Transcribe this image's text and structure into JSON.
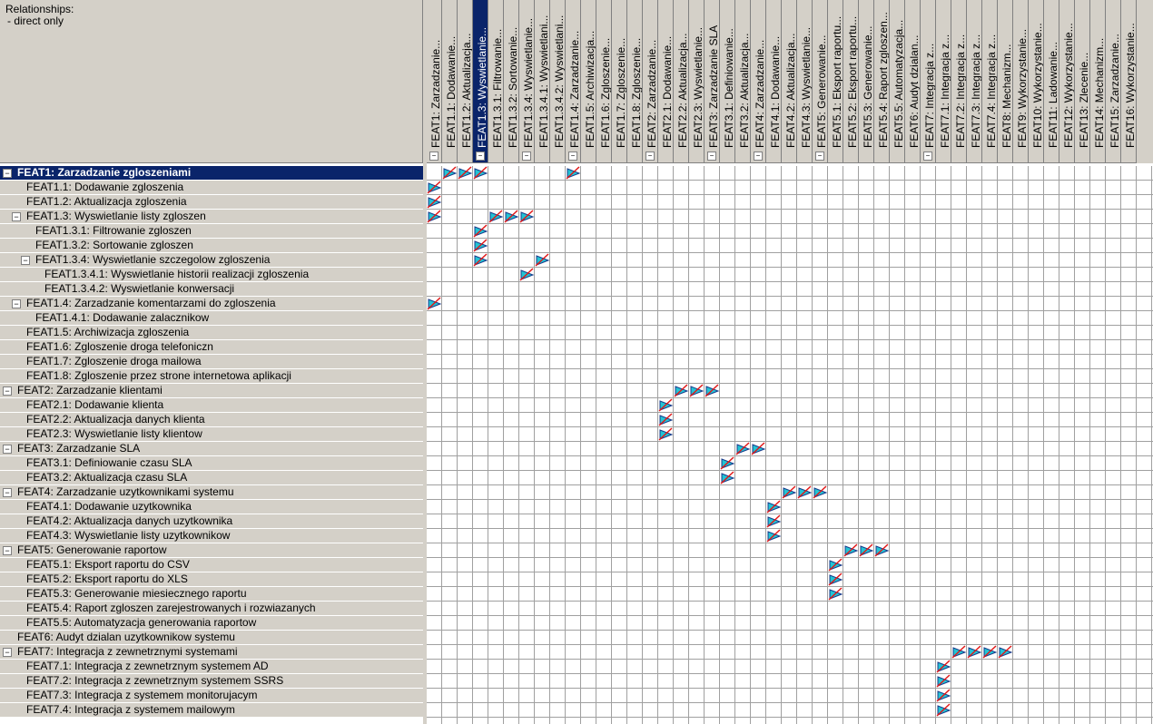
{
  "header": {
    "title": "Relationships:",
    "filter": "- direct only"
  },
  "columns": [
    {
      "label": "FEAT1: Zarzadzanie...",
      "toggle": "⊟"
    },
    {
      "label": "FEAT1.1: Dodawanie...",
      "toggle": ""
    },
    {
      "label": "FEAT1.2: Aktualizacja...",
      "toggle": ""
    },
    {
      "label": "FEAT1.3: Wyswietlanie...",
      "toggle": "⊟"
    },
    {
      "label": "FEAT1.3.1: Filtrowanie...",
      "toggle": ""
    },
    {
      "label": "FEAT1.3.2: Sortowanie...",
      "toggle": ""
    },
    {
      "label": "FEAT1.3.4: Wyswietlanie...",
      "toggle": "⊟"
    },
    {
      "label": "FEAT1.3.4.1: Wyswietlani...",
      "toggle": ""
    },
    {
      "label": "FEAT1.3.4.2: Wyswietlani...",
      "toggle": ""
    },
    {
      "label": "FEAT1.4: Zarzadzanie...",
      "toggle": "⊟"
    },
    {
      "label": "FEAT1.5: Archiwizacja...",
      "toggle": ""
    },
    {
      "label": "FEAT1.6: Zgloszenie...",
      "toggle": ""
    },
    {
      "label": "FEAT1.7: Zgloszenie...",
      "toggle": ""
    },
    {
      "label": "FEAT1.8: Zgloszenie...",
      "toggle": ""
    },
    {
      "label": "FEAT2: Zarzadzanie...",
      "toggle": "⊟"
    },
    {
      "label": "FEAT2.1: Dodawanie...",
      "toggle": ""
    },
    {
      "label": "FEAT2.2: Aktualizacja...",
      "toggle": ""
    },
    {
      "label": "FEAT2.3: Wyswietlanie...",
      "toggle": ""
    },
    {
      "label": "FEAT3: Zarzadzanie SLA",
      "toggle": "⊟"
    },
    {
      "label": "FEAT3.1: Definiowanie...",
      "toggle": ""
    },
    {
      "label": "FEAT3.2: Aktualizacja...",
      "toggle": ""
    },
    {
      "label": "FEAT4: Zarzadzanie...",
      "toggle": "⊟"
    },
    {
      "label": "FEAT4.1: Dodawanie...",
      "toggle": ""
    },
    {
      "label": "FEAT4.2: Aktualizacja...",
      "toggle": ""
    },
    {
      "label": "FEAT4.3: Wyswietlanie...",
      "toggle": ""
    },
    {
      "label": "FEAT5: Generowanie...",
      "toggle": "⊟"
    },
    {
      "label": "FEAT5.1: Eksport raportu...",
      "toggle": ""
    },
    {
      "label": "FEAT5.2: Eksport raportu...",
      "toggle": ""
    },
    {
      "label": "FEAT5.3: Generowanie...",
      "toggle": ""
    },
    {
      "label": "FEAT5.4: Raport zgloszen...",
      "toggle": ""
    },
    {
      "label": "FEAT5.5: Automatyzacja...",
      "toggle": ""
    },
    {
      "label": "FEAT6: Audyt dzialan...",
      "toggle": ""
    },
    {
      "label": "FEAT7: Integracja z...",
      "toggle": "⊟"
    },
    {
      "label": "FEAT7.1: Integracja z...",
      "toggle": ""
    },
    {
      "label": "FEAT7.2: Integracja z...",
      "toggle": ""
    },
    {
      "label": "FEAT7.3: Integracja z...",
      "toggle": ""
    },
    {
      "label": "FEAT7.4: Integracja z...",
      "toggle": ""
    },
    {
      "label": "FEAT8: Mechanizm...",
      "toggle": ""
    },
    {
      "label": "FEAT9: Wykorzystanie...",
      "toggle": ""
    },
    {
      "label": "FEAT10: Wykorzystanie...",
      "toggle": ""
    },
    {
      "label": "FEAT11: Ladowanie...",
      "toggle": ""
    },
    {
      "label": "FEAT12: Wykorzystanie...",
      "toggle": ""
    },
    {
      "label": "FEAT13: Zlecenie...",
      "toggle": ""
    },
    {
      "label": "FEAT14: Mechanizm...",
      "toggle": ""
    },
    {
      "label": "FEAT15: Zarzadzanie...",
      "toggle": ""
    },
    {
      "label": "FEAT16: Wykorzystanie...",
      "toggle": ""
    }
  ],
  "selected_column": 3,
  "rows": [
    {
      "label": "FEAT1: Zarzadzanie zgloszeniami",
      "level": 0,
      "toggle": "⊟",
      "selected": true
    },
    {
      "label": "FEAT1.1: Dodawanie zgloszenia",
      "level": 1,
      "toggle": ""
    },
    {
      "label": "FEAT1.2: Aktualizacja zgloszenia",
      "level": 1,
      "toggle": ""
    },
    {
      "label": "FEAT1.3: Wyswietlanie listy zgloszen",
      "level": 1,
      "toggle": "⊟"
    },
    {
      "label": "FEAT1.3.1: Filtrowanie zgloszen",
      "level": 2,
      "toggle": ""
    },
    {
      "label": "FEAT1.3.2: Sortowanie zgloszen",
      "level": 2,
      "toggle": ""
    },
    {
      "label": "FEAT1.3.4: Wyswietlanie szczegolow zgloszenia",
      "level": 2,
      "toggle": "⊟"
    },
    {
      "label": "FEAT1.3.4.1: Wyswietlanie historii realizacji zgloszenia",
      "level": 3,
      "toggle": ""
    },
    {
      "label": "FEAT1.3.4.2: Wyswietlanie konwersacji",
      "level": 3,
      "toggle": ""
    },
    {
      "label": "FEAT1.4: Zarzadzanie komentarzami do zgloszenia",
      "level": 1,
      "toggle": "⊟"
    },
    {
      "label": "FEAT1.4.1: Dodawanie zalacznikow",
      "level": 2,
      "toggle": ""
    },
    {
      "label": "FEAT1.5: Archiwizacja zgloszenia",
      "level": 1,
      "toggle": ""
    },
    {
      "label": "FEAT1.6: Zgloszenie droga telefoniczn",
      "level": 1,
      "toggle": ""
    },
    {
      "label": "FEAT1.7: Zgloszenie droga mailowa",
      "level": 1,
      "toggle": ""
    },
    {
      "label": "FEAT1.8: Zgloszenie przez strone internetowa aplikacji",
      "level": 1,
      "toggle": ""
    },
    {
      "label": "FEAT2: Zarzadzanie klientami",
      "level": 0,
      "toggle": "⊟"
    },
    {
      "label": "FEAT2.1: Dodawanie klienta",
      "level": 1,
      "toggle": ""
    },
    {
      "label": "FEAT2.2: Aktualizacja danych klienta",
      "level": 1,
      "toggle": ""
    },
    {
      "label": "FEAT2.3: Wyswietlanie listy klientow",
      "level": 1,
      "toggle": ""
    },
    {
      "label": "FEAT3: Zarzadzanie SLA",
      "level": 0,
      "toggle": "⊟"
    },
    {
      "label": "FEAT3.1: Definiowanie czasu SLA",
      "level": 1,
      "toggle": ""
    },
    {
      "label": "FEAT3.2: Aktualizacja czasu SLA",
      "level": 1,
      "toggle": ""
    },
    {
      "label": "FEAT4: Zarzadzanie uzytkownikami systemu",
      "level": 0,
      "toggle": "⊟"
    },
    {
      "label": "FEAT4.1: Dodawanie uzytkownika",
      "level": 1,
      "toggle": ""
    },
    {
      "label": "FEAT4.2: Aktualizacja danych uzytkownika",
      "level": 1,
      "toggle": ""
    },
    {
      "label": "FEAT4.3: Wyswietlanie listy uzytkownikow",
      "level": 1,
      "toggle": ""
    },
    {
      "label": "FEAT5: Generowanie raportow",
      "level": 0,
      "toggle": "⊟"
    },
    {
      "label": "FEAT5.1: Eksport raportu do CSV",
      "level": 1,
      "toggle": ""
    },
    {
      "label": "FEAT5.2: Eksport raportu do XLS",
      "level": 1,
      "toggle": ""
    },
    {
      "label": "FEAT5.3: Generowanie miesiecznego raportu",
      "level": 1,
      "toggle": ""
    },
    {
      "label": "FEAT5.4: Raport zgloszen zarejestrowanych i rozwiazanych",
      "level": 1,
      "toggle": ""
    },
    {
      "label": "FEAT5.5: Automatyzacja generowania raportow",
      "level": 1,
      "toggle": ""
    },
    {
      "label": "FEAT6: Audyt dzialan uzytkownikow systemu",
      "level": 0,
      "toggle": ""
    },
    {
      "label": "FEAT7: Integracja z zewnetrznymi systemami",
      "level": 0,
      "toggle": "⊟"
    },
    {
      "label": "FEAT7.1: Integracja z zewnetrznym systemem AD",
      "level": 1,
      "toggle": ""
    },
    {
      "label": "FEAT7.2: Integracja z zewnetrznym systemem SSRS",
      "level": 1,
      "toggle": ""
    },
    {
      "label": "FEAT7.3: Integracja z systemem monitorujacym",
      "level": 1,
      "toggle": ""
    },
    {
      "label": "FEAT7.4: Integracja z systemem mailowym",
      "level": 1,
      "toggle": ""
    }
  ],
  "relationships": [
    [
      0,
      1
    ],
    [
      0,
      2
    ],
    [
      0,
      3
    ],
    [
      0,
      9
    ],
    [
      1,
      0
    ],
    [
      2,
      0
    ],
    [
      3,
      0
    ],
    [
      3,
      4
    ],
    [
      3,
      5
    ],
    [
      3,
      6
    ],
    [
      4,
      3
    ],
    [
      5,
      3
    ],
    [
      6,
      3
    ],
    [
      6,
      7
    ],
    [
      7,
      6
    ],
    [
      9,
      0
    ],
    [
      15,
      16
    ],
    [
      15,
      17
    ],
    [
      15,
      18
    ],
    [
      16,
      15
    ],
    [
      17,
      15
    ],
    [
      18,
      15
    ],
    [
      19,
      20
    ],
    [
      19,
      21
    ],
    [
      20,
      19
    ],
    [
      21,
      19
    ],
    [
      22,
      23
    ],
    [
      22,
      24
    ],
    [
      22,
      25
    ],
    [
      23,
      22
    ],
    [
      24,
      22
    ],
    [
      25,
      22
    ],
    [
      26,
      27
    ],
    [
      26,
      28
    ],
    [
      26,
      29
    ],
    [
      27,
      26
    ],
    [
      28,
      26
    ],
    [
      29,
      26
    ],
    [
      33,
      34
    ],
    [
      33,
      35
    ],
    [
      33,
      36
    ],
    [
      33,
      37
    ],
    [
      34,
      33
    ],
    [
      35,
      33
    ],
    [
      36,
      33
    ],
    [
      37,
      33
    ]
  ],
  "colors": {
    "panel_bg": "#d4d0c8",
    "selection": "#0a246a",
    "grid_line": "#a0a0a0",
    "arrow_fill": "#22c4d4",
    "arrow_stroke": "#1a3a8a",
    "strike": "#e01818"
  }
}
